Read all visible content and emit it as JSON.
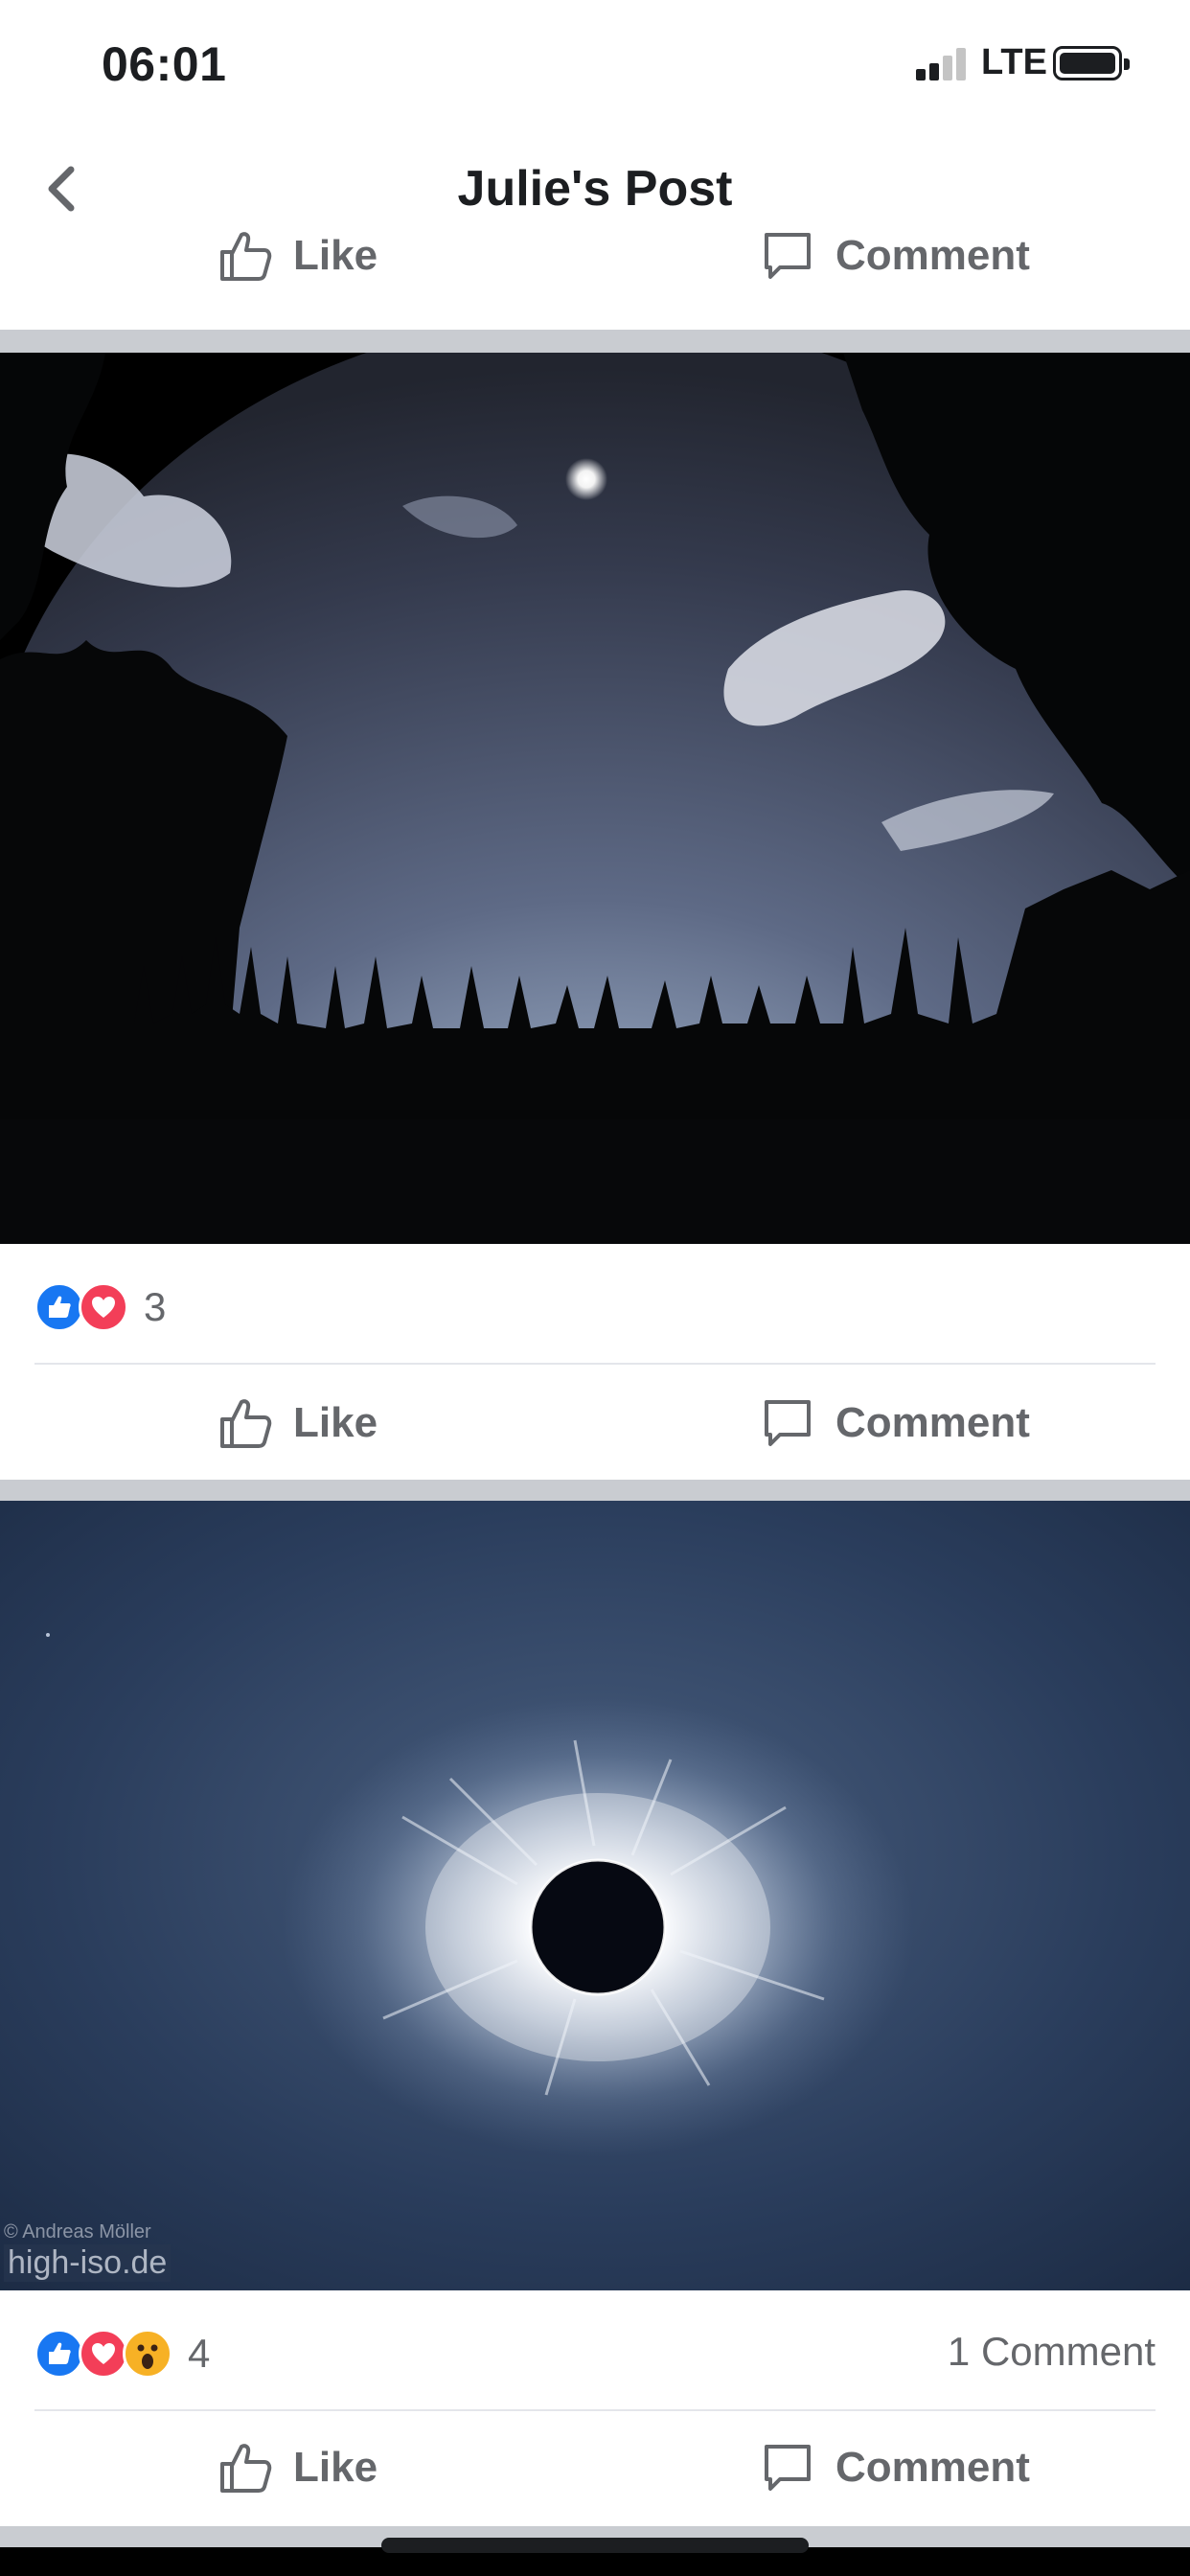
{
  "status_bar": {
    "time": "06:01",
    "network": "LTE",
    "signal_bars": 2,
    "battery_level": 0.9
  },
  "nav": {
    "title": "Julie's Post",
    "back_icon": "chevron-left-icon"
  },
  "posts": [
    {
      "actions": {
        "like": "Like",
        "comment": "Comment"
      }
    },
    {
      "photo_description_icon": "sky-photo",
      "reactions": [
        "like",
        "love"
      ],
      "reaction_count": "3",
      "actions": {
        "like": "Like",
        "comment": "Comment"
      }
    },
    {
      "photo_description_icon": "eclipse-photo",
      "watermark_lines": [
        "© Andreas Möller",
        "high-iso.de"
      ],
      "reactions": [
        "like",
        "love",
        "wow"
      ],
      "reaction_count": "4",
      "comment_count": "1 Comment",
      "actions": {
        "like": "Like",
        "comment": "Comment"
      }
    }
  ],
  "colors": {
    "like_blue": "#1877f2",
    "love_red": "#f33e58",
    "wow_yellow": "#f7b125",
    "text_gray": "#65676b"
  }
}
